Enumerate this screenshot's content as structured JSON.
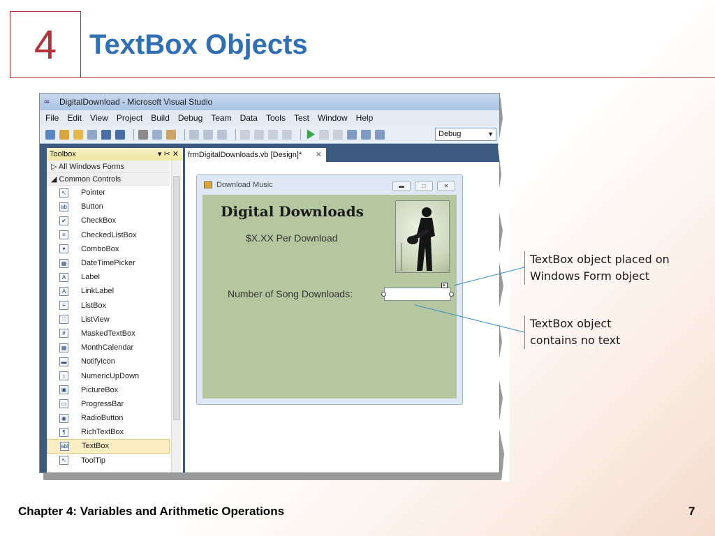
{
  "slide": {
    "chapter_number": "4",
    "title": "TextBox Objects",
    "footer_left": "Chapter 4: Variables and Arithmetic Operations",
    "page_number": "7"
  },
  "vs": {
    "window_title": "DigitalDownload - Microsoft Visual Studio",
    "menu": [
      "File",
      "Edit",
      "View",
      "Project",
      "Build",
      "Debug",
      "Team",
      "Data",
      "Tools",
      "Test",
      "Window",
      "Help"
    ],
    "config_value": "Debug"
  },
  "toolbox": {
    "title": "Toolbox",
    "pin_glyphs": "▾ ✂ ✕",
    "groups": [
      "▷ All Windows Forms",
      "◢ Common Controls"
    ],
    "items": [
      {
        "label": "Pointer",
        "icon": "pointer-icon",
        "glyph": "↖"
      },
      {
        "label": "Button",
        "icon": "button-icon",
        "glyph": "ab"
      },
      {
        "label": "CheckBox",
        "icon": "checkbox-icon",
        "glyph": "✔"
      },
      {
        "label": "CheckedListBox",
        "icon": "checkedlistbox-icon",
        "glyph": "≡"
      },
      {
        "label": "ComboBox",
        "icon": "combobox-icon",
        "glyph": "▾"
      },
      {
        "label": "DateTimePicker",
        "icon": "datetimepicker-icon",
        "glyph": "▦"
      },
      {
        "label": "Label",
        "icon": "label-icon",
        "glyph": "A"
      },
      {
        "label": "LinkLabel",
        "icon": "linklabel-icon",
        "glyph": "A"
      },
      {
        "label": "ListBox",
        "icon": "listbox-icon",
        "glyph": "≡"
      },
      {
        "label": "ListView",
        "icon": "listview-icon",
        "glyph": "∷"
      },
      {
        "label": "MaskedTextBox",
        "icon": "maskedtextbox-icon",
        "glyph": "#"
      },
      {
        "label": "MonthCalendar",
        "icon": "monthcalendar-icon",
        "glyph": "▦"
      },
      {
        "label": "NotifyIcon",
        "icon": "notifyicon-icon",
        "glyph": "▬"
      },
      {
        "label": "NumericUpDown",
        "icon": "numericupdown-icon",
        "glyph": "↕"
      },
      {
        "label": "PictureBox",
        "icon": "picturebox-icon",
        "glyph": "▣"
      },
      {
        "label": "ProgressBar",
        "icon": "progressbar-icon",
        "glyph": "▭"
      },
      {
        "label": "RadioButton",
        "icon": "radiobutton-icon",
        "glyph": "◉"
      },
      {
        "label": "RichTextBox",
        "icon": "richtextbox-icon",
        "glyph": "¶"
      },
      {
        "label": "TextBox",
        "icon": "textbox-icon",
        "glyph": "abl",
        "selected": true
      },
      {
        "label": "ToolTip",
        "icon": "tooltip-icon",
        "glyph": "↖"
      }
    ]
  },
  "designer": {
    "tab_label": "frmDigitalDownloads.vb [Design]*",
    "tab_close": "✕",
    "form_title": "Download Music",
    "heading": "Digital Downloads",
    "price": "$X.XX Per Download",
    "songs_label": "Number of Song Downloads:"
  },
  "callouts": {
    "textbox_placed": [
      "TextBox object placed on",
      "Windows Form object"
    ],
    "no_text": [
      "TextBox object",
      "contains no text"
    ],
    "line_color": "#3a92c8"
  },
  "colors": {
    "accent_red": "#b5323a",
    "title_blue": "#2e6fb5",
    "form_green": "#b5c79f"
  }
}
